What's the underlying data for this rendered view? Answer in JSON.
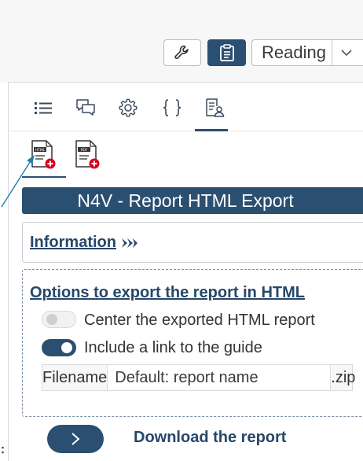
{
  "toolbar": {
    "wrench_icon": "wrench-icon",
    "clipboard_icon": "clipboard-icon",
    "view_select": {
      "selected": "Reading"
    }
  },
  "tabs": [
    {
      "icon": "list-icon"
    },
    {
      "icon": "comments-icon"
    },
    {
      "icon": "gear-icon"
    },
    {
      "icon": "braces-icon"
    },
    {
      "icon": "report-user-icon",
      "active": true
    }
  ],
  "export_types": [
    {
      "icon_text": "HTML",
      "active": true
    },
    {
      "icon_text": "PDF",
      "active": false
    }
  ],
  "panel": {
    "title": "N4V - Report HTML Export",
    "information_link": "Information"
  },
  "options": {
    "title": "Options to export the report in HTML",
    "center_report": {
      "label": "Center the exported HTML report",
      "checked": false
    },
    "include_link": {
      "label": "Include a link to the guide",
      "checked": true
    },
    "filename": {
      "label": "Filename",
      "placeholder": "Default: report name",
      "extension": ".zip"
    }
  },
  "download": {
    "label": "Download the report"
  },
  "colors": {
    "primary": "#2b4f70",
    "link": "#26476a",
    "badge_red": "#d6001c",
    "annotation_arrow": "#1f7fa8"
  }
}
